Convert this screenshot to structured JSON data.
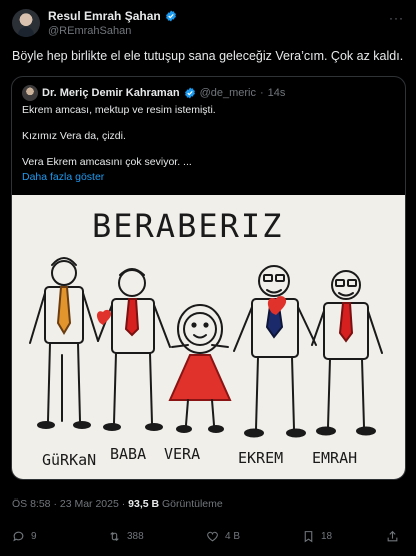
{
  "author": {
    "name": "Resul Emrah Şahan",
    "handle": "@REmrahSahan",
    "more": "···"
  },
  "tweet": {
    "text": "Böyle hep birlikte el ele tutuşup sana geleceğiz Vera’cım. Çok az kaldı."
  },
  "quote": {
    "author_name": "Dr. Meriç Demir Kahraman",
    "handle": "@de_meric",
    "separator": "·",
    "time": "14s",
    "lines": [
      "Ekrem amcası, mektup ve resim istemişti.",
      "Kızımız Vera da, çizdi.",
      "Vera Ekrem amcasını çok seviyor. ..."
    ],
    "show_more": "Daha fazla göster"
  },
  "drawing": {
    "title": "BERABERIZ",
    "names": [
      "GüRKaN",
      "BABA",
      "VERA",
      "EKREM",
      "EMRAH"
    ]
  },
  "meta": {
    "timestamp": "ÖS 8:58 · 23 Mar 2025 ·",
    "views_count": "93,5 B",
    "views_label": "Görüntüleme"
  },
  "actions": {
    "replies": "9",
    "reposts": "388",
    "likes": "4 B",
    "bookmarks": "18"
  },
  "colors": {
    "accent": "#1d9bf0",
    "muted": "#71767b",
    "heart": "#e0322b"
  }
}
